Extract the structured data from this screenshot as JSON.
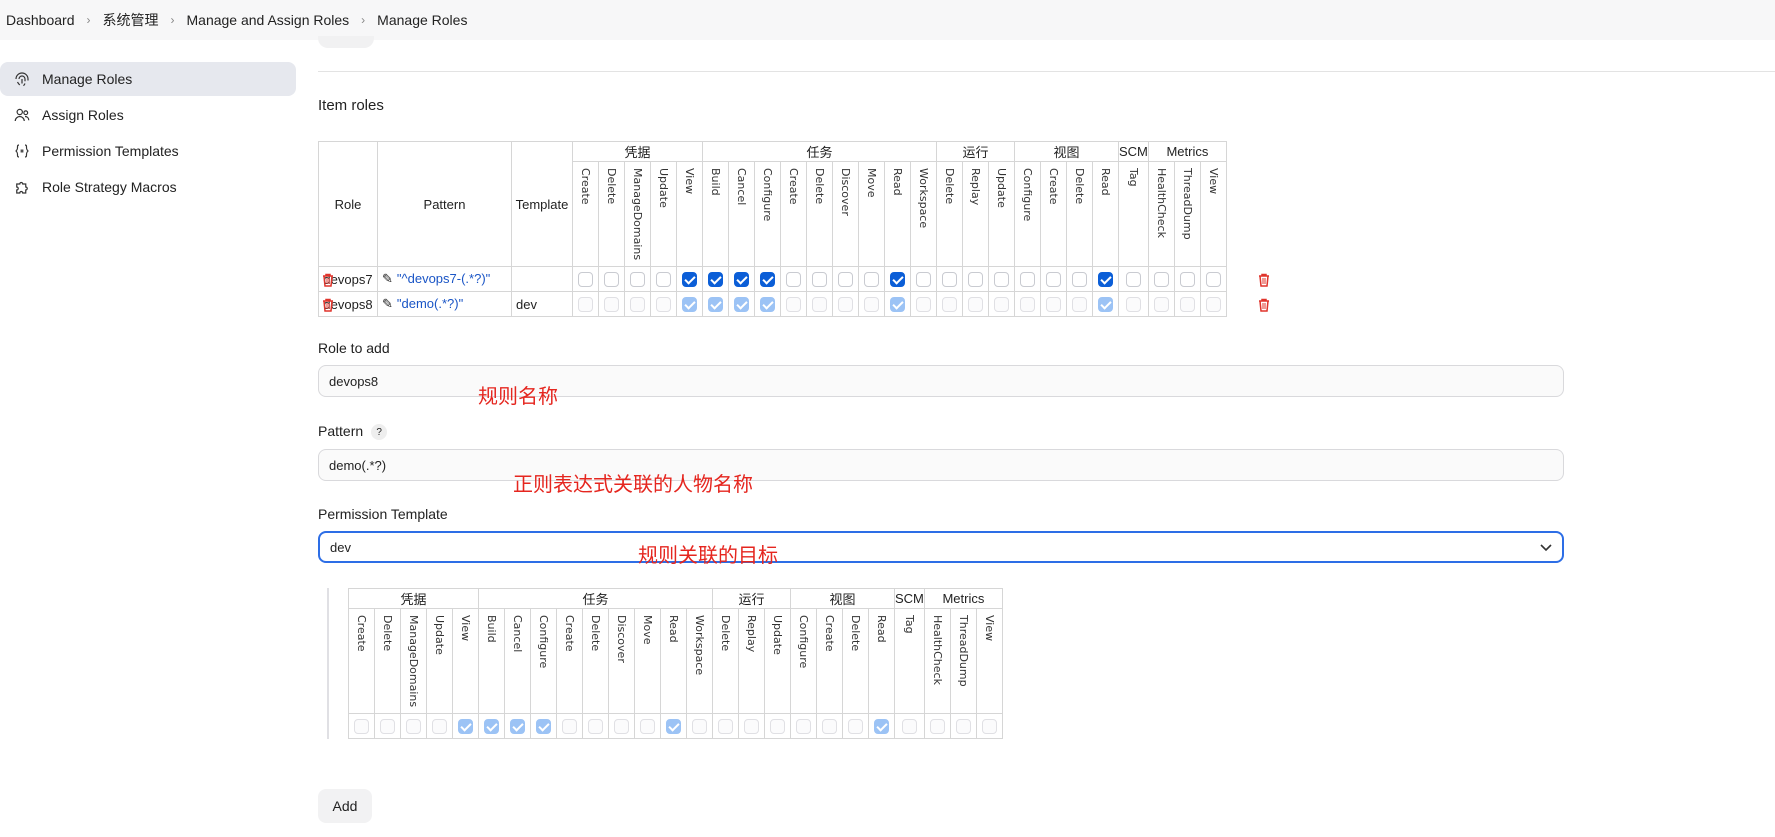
{
  "breadcrumb": [
    "Dashboard",
    "系统管理",
    "Manage and Assign Roles",
    "Manage Roles"
  ],
  "sidebar": {
    "items": [
      {
        "label": "Manage Roles",
        "icon": "fingerprint-icon",
        "active": true
      },
      {
        "label": "Assign Roles",
        "icon": "users-icon",
        "active": false
      },
      {
        "label": "Permission Templates",
        "icon": "braces-icon",
        "active": false
      },
      {
        "label": "Role Strategy Macros",
        "icon": "puzzle-icon",
        "active": false
      }
    ]
  },
  "item_roles": {
    "title": "Item roles",
    "headers": {
      "role": "Role",
      "pattern": "Pattern",
      "template": "Template"
    },
    "groups": [
      {
        "name": "凭据",
        "perms": [
          "Create",
          "Delete",
          "ManageDomains",
          "Update",
          "View"
        ]
      },
      {
        "name": "任务",
        "perms": [
          "Build",
          "Cancel",
          "Configure",
          "Create",
          "Delete",
          "Discover",
          "Move",
          "Read",
          "Workspace"
        ]
      },
      {
        "name": "运行",
        "perms": [
          "Delete",
          "Replay",
          "Update"
        ]
      },
      {
        "name": "视图",
        "perms": [
          "Configure",
          "Create",
          "Delete",
          "Read"
        ]
      },
      {
        "name": "SCM",
        "perms": [
          "Tag"
        ]
      },
      {
        "name": "Metrics",
        "perms": [
          "HealthCheck",
          "ThreadDump",
          "View"
        ]
      }
    ],
    "rows": [
      {
        "role": "devops7",
        "pattern": "\"^devops7-(.*?)\"",
        "template": "",
        "state": "active",
        "checks": [
          0,
          0,
          0,
          0,
          1,
          1,
          1,
          1,
          0,
          0,
          0,
          0,
          1,
          0,
          0,
          0,
          0,
          0,
          0,
          0,
          1,
          0,
          0,
          0,
          0
        ]
      },
      {
        "role": "devops8",
        "pattern": "\"demo(.*?)\"",
        "template": "dev",
        "state": "dim",
        "checks": [
          0,
          0,
          0,
          0,
          1,
          1,
          1,
          1,
          0,
          0,
          0,
          0,
          1,
          0,
          0,
          0,
          0,
          0,
          0,
          0,
          1,
          0,
          0,
          0,
          0
        ]
      }
    ]
  },
  "form": {
    "role_to_add_label": "Role to add",
    "role_to_add_value": "devops8",
    "pattern_label": "Pattern",
    "pattern_help": "?",
    "pattern_value": "demo(.*?)",
    "template_label": "Permission Template",
    "template_value": "dev",
    "add_button": "Add"
  },
  "annotations": {
    "role_name": "规则名称",
    "pattern": "正则表达式关联的人物名称",
    "template": "规则关联的目标"
  },
  "template_preview": {
    "checks": [
      0,
      0,
      0,
      0,
      1,
      1,
      1,
      1,
      0,
      0,
      0,
      0,
      1,
      0,
      0,
      0,
      0,
      0,
      0,
      0,
      1,
      0,
      0,
      0,
      0
    ]
  },
  "colors": {
    "accent": "#0b5ed7",
    "annotation": "#e5261f",
    "trash": "#e0342b"
  }
}
